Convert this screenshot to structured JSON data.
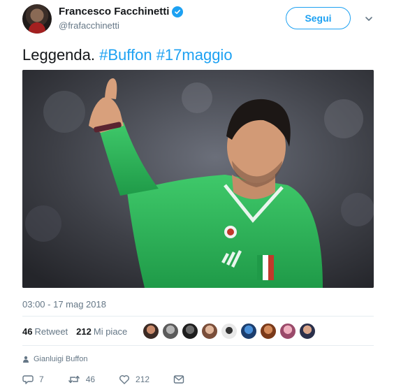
{
  "author": {
    "display_name": "Francesco Facchinetti",
    "handle": "@frafacchinetti",
    "verified": true
  },
  "follow_button": {
    "label": "Segui"
  },
  "tweet": {
    "text_plain": "Leggenda. ",
    "hashtags": [
      "#Buffon",
      "#17maggio"
    ],
    "timestamp": "03:00 - 17 mag 2018"
  },
  "stats": {
    "retweets_count": "46",
    "retweets_label": "Retweet",
    "likes_count": "212",
    "likes_label": "Mi piace",
    "liker_avatars": 9
  },
  "reply_context": {
    "name": "Gianluigi Buffon"
  },
  "actions": {
    "reply_count": "7",
    "retweet_count": "46",
    "like_count": "212"
  },
  "colors": {
    "accent": "#1da1f2",
    "muted": "#657786",
    "text": "#14171a",
    "divider": "#e6ecf0"
  },
  "icons": [
    "verified-badge-icon",
    "chevron-down-icon",
    "photo-icon",
    "reply-icon",
    "retweet-icon",
    "like-icon",
    "message-icon"
  ]
}
